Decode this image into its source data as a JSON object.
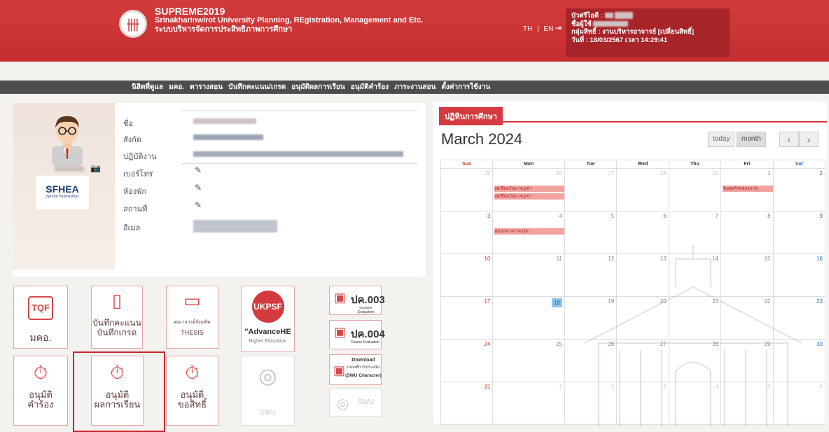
{
  "header": {
    "app_title": "SUPREME2019",
    "subtitle_en": "Srinakharinwirot University Planning, REgistration, Management and Etc.",
    "subtitle_th": "ระบบบริหารจัดการประสิทธิภาพการศึกษา",
    "lang_th": "TH",
    "lang_sep": "|",
    "lang_en": "EN",
    "user": {
      "code_label": "บัวศรีไอดี :",
      "name_label": "ชื่อผู้ใช้",
      "group": "กลุ่มสิทธิ์ : งานบริหารอาจารย์ [เปลี่ยนสิทธิ์]",
      "datetime": "วันที่ : 18/03/2567 เวลา 14:29:41"
    }
  },
  "nav": [
    "นิสิตที่ดูแล",
    "มคอ.",
    "ตารางสอน",
    "บันทึกคะแนน/เกรด",
    "อนุมัติผลการเรียน",
    "อนุมัติคำร้อง",
    "ภาระงานสอน",
    "ตั้งค่าการใช้งาน"
  ],
  "profile": {
    "sfhea": "SFHEA",
    "sfhea_sub": "(Senior Fellowship)",
    "fields": [
      "ชื่อ",
      "สังกัด",
      "ปฏิบัติงาน",
      "เบอร์โทร",
      "ห้องพัก",
      "สถานที่",
      "อีเมล"
    ]
  },
  "tiles": {
    "tqf": "มคอ.",
    "tqf_icon": "TQF",
    "record": [
      "บันทึกคะแนน",
      "บันทึกเกรด"
    ],
    "thesis_top": "คณาจารย์บัณฑิต",
    "thesis": "THESIS",
    "ukpsf": "UKPSF",
    "advancehe": "\"AdvanceHE",
    "advancehe_sub": "Higher Education",
    "pk003": "ปค.003",
    "pk003_sub": "Lecturer Evaluation",
    "pk004": "ปค.004",
    "pk004_sub": "Course Evaluation",
    "download": "Download",
    "download_sub1": "เกณฑ์การประเมิน",
    "download_sub2": "(SWU Character)",
    "approve_req_top": "อนุมัติ",
    "approve_req": "คำร้อง",
    "approve_grade_top": "อนุมัติ",
    "approve_grade": "ผลการเรียน",
    "approve_rights_top": "อนุมัติ",
    "approve_rights": "ขอสิทธิ์",
    "swu": "SWU",
    "swu2": "SWU"
  },
  "calendar": {
    "tab": "ปฏิทินการศึกษา",
    "title": "March 2024",
    "today": "today",
    "month": "month",
    "prev": "‹",
    "next": "›",
    "days": [
      "Sun",
      "Mon",
      "Tue",
      "Wed",
      "Thu",
      "Fri",
      "Sat"
    ],
    "weeks": [
      [
        "25",
        "26",
        "27",
        "28",
        "29",
        "1",
        "2"
      ],
      [
        "3",
        "4",
        "5",
        "6",
        "7",
        "8",
        "9"
      ],
      [
        "10",
        "11",
        "12",
        "13",
        "14",
        "15",
        "16"
      ],
      [
        "17",
        "18",
        "19",
        "20",
        "21",
        "22",
        "23"
      ],
      [
        "24",
        "25",
        "26",
        "27",
        "28",
        "29",
        "30"
      ],
      [
        "31",
        "1",
        "2",
        "3",
        "4",
        "5",
        "6"
      ]
    ],
    "events": {
      "mon26_a": "งดเรียนวันมาฆบูชา",
      "mon26_b": "งดเรียนวันมาฆบูชา",
      "fri1": "วันสุดท้ายของการเ",
      "mon4": "สอบกลางภาค (Mi"
    }
  }
}
